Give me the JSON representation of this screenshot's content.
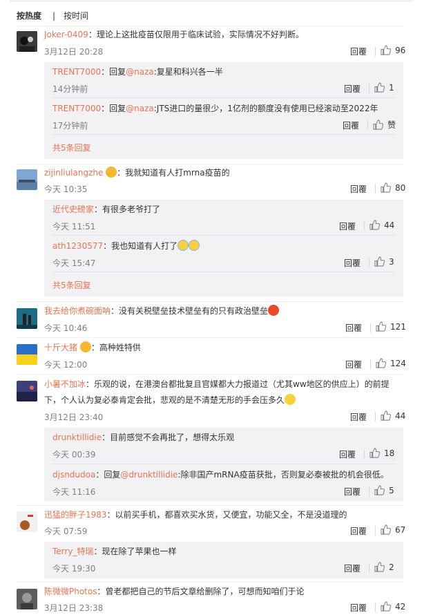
{
  "sort_tabs": [
    "按热度",
    "按时间"
  ],
  "reply_label": "回覆",
  "reply_label_main": "回覆",
  "comments": [
    {
      "user": "Joker-0409",
      "text": "：理论上这批疫苗仅限用于临床试验，实际情况不好判断。",
      "time": "3月12日 20:28",
      "likes": "96",
      "replies": [
        {
          "user": "TRENT7000",
          "text": "：回复",
          "mention": "@naza",
          "rest": ":复星和科兴各一半",
          "time": "14分钟前",
          "likes": "1"
        },
        {
          "user": "TRENT7000",
          "text": "：回复",
          "mention": "@naza",
          "rest": ":JTS进口的量很少，1亿剂的额度没有使用已经滚动至2022年",
          "time": "17分钟前",
          "likes": "赞"
        }
      ],
      "more": "共5条回复"
    },
    {
      "user": "zijinliulangzhe",
      "text": "：我就知道有人打mrna疫苗的",
      "time": "今天 10:35",
      "likes": "80",
      "replies": [
        {
          "user": "近代史磅家",
          "text": "：有很多老爷打了",
          "mention": "",
          "rest": "",
          "time": "今天 11:51",
          "likes": "44"
        },
        {
          "user": "ath1230577",
          "text": "：我也知道有人打了",
          "mention": "",
          "rest": "",
          "time": "今天 15:47",
          "likes": "3"
        }
      ],
      "more": "共5条回复"
    },
    {
      "user": "我去给你煮碗面呐",
      "text": "：没有关税壁垒技术壁垒有的只有政治壁垒",
      "time": "今天 10:46",
      "likes": "121"
    },
    {
      "user": "十斤大猪",
      "text": "：高种姓特供",
      "time": "今天 12:00",
      "likes": "124"
    },
    {
      "user": "小暑不加冰",
      "text": "：乐观的说，在港澳台都批复且官媒都大力报道过（尤其ww地区的供应上）的前提",
      "text2": "下，个人认为复必泰肯定会批，悲观的是不清楚无形的手会压多久",
      "time": "3月12日 23:40",
      "likes": "44",
      "replies": [
        {
          "user": "drunktillidie",
          "text": "：目前感觉不会再批了，想得太乐观",
          "mention": "",
          "rest": "",
          "time": "今天 00:39",
          "likes": "18"
        },
        {
          "user": "djsndudoa",
          "text": "：回复",
          "mention": "@drunktillidie",
          "rest": ":除非国产mRNA疫苗获批，否则复必泰被批的机会很低。",
          "time": "今天 11:16",
          "likes": "5"
        }
      ]
    },
    {
      "user": "迅猛的胖子1983",
      "text": "：以前买手机，都喜欢买水货，又便宜，功能又全，不是没道理的",
      "time": "今天 07:59",
      "likes": "67",
      "replies": [
        {
          "user": "Terry_特瑞",
          "text": "：现在除了苹果也一样",
          "mention": "",
          "rest": "",
          "time": "今天 19:30",
          "likes": "2"
        }
      ]
    },
    {
      "user": "陈微微Photos",
      "text": "：曾老都把自己的节后文章给删除了，可想而知咱们于论",
      "time": "3月12日 23:38",
      "likes": "42"
    }
  ],
  "colors": {
    "accent": "#eb7350",
    "reply_bg": "#f2f2f5",
    "time": "#808080"
  },
  "icons": [
    "thumbs-up-icon",
    "laugh-cry-emoji",
    "angry-face-emoji",
    "shy-emoji",
    "fist-emoji"
  ]
}
